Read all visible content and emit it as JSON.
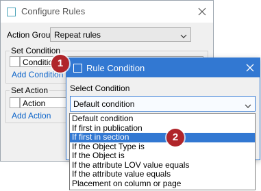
{
  "configure_rules": {
    "title": "Configure Rules",
    "action_group_label": "Action Group",
    "action_group_value": "Repeat rules",
    "set_condition_legend": "Set Condition",
    "condition_header": "Condition",
    "add_condition": "Add Condition",
    "set_action_legend": "Set Action",
    "action_header": "Action",
    "add_action": "Add Action"
  },
  "rule_condition": {
    "title": "Rule Condition",
    "select_label": "Select Condition",
    "selected_value": "Default condition",
    "options": [
      "Default condition",
      "If first in publication",
      "If first in section",
      "If the Object Type is",
      "If the Object is",
      "If the attribute LOV value equals",
      "If the attribute value equals",
      "Placement on column or page"
    ],
    "highlighted_option": "If first in section"
  },
  "callouts": [
    "1",
    "2"
  ],
  "colors": {
    "accent_blue": "#3278d2",
    "badge_red": "#b0252a",
    "link_blue": "#0a63c9",
    "title_icon_teal": "#4aa3b8"
  }
}
